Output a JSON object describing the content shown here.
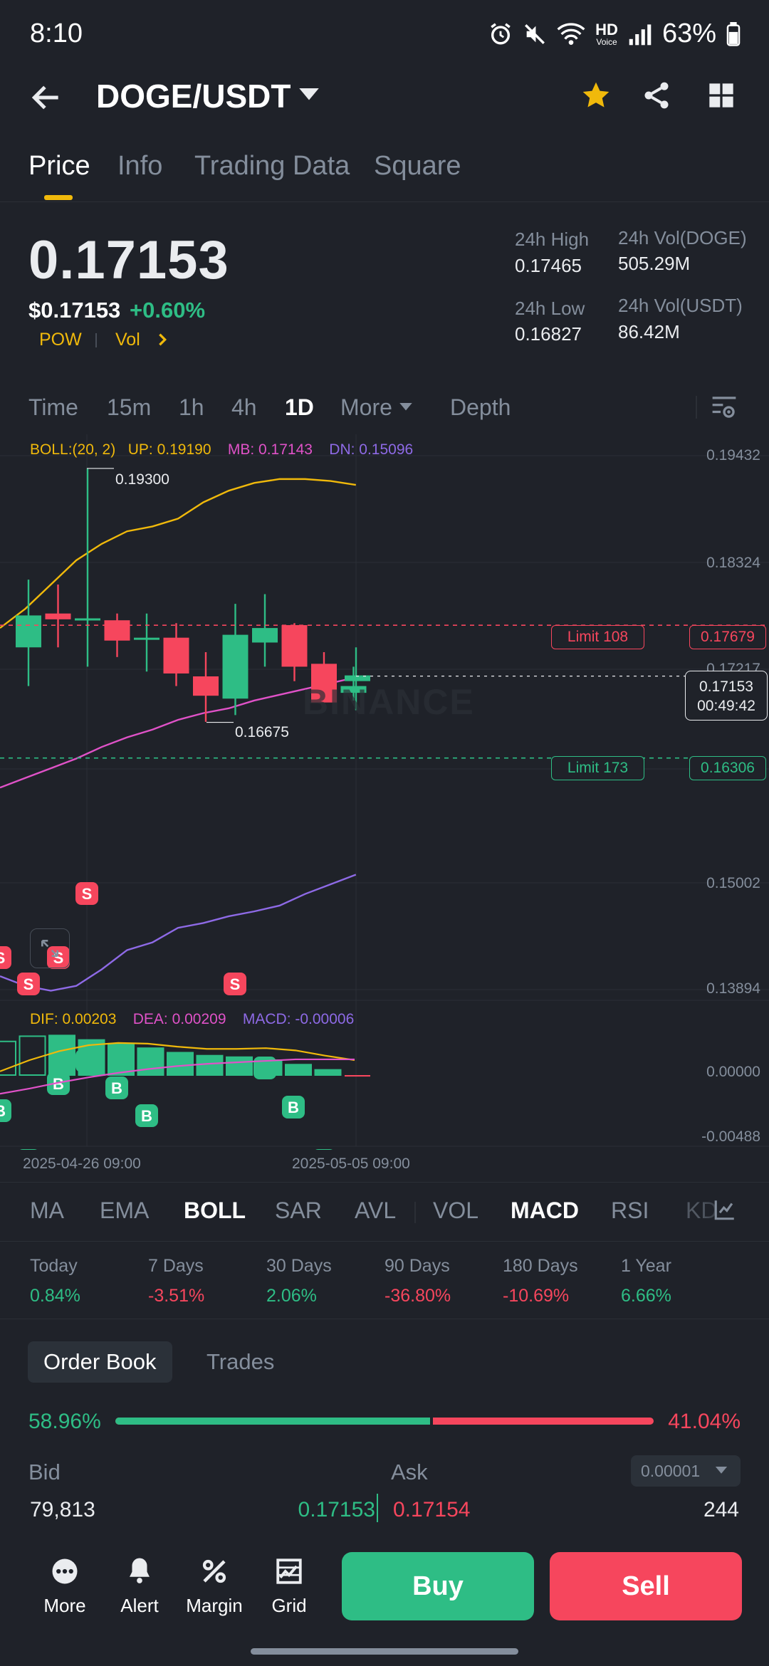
{
  "status_bar": {
    "time": "8:10",
    "hd": "HD",
    "hd_sub": "Voice",
    "battery": "63%"
  },
  "header": {
    "pair": "DOGE/USDT"
  },
  "tabs": [
    {
      "label": "Price"
    },
    {
      "label": "Info"
    },
    {
      "label": "Trading Data"
    },
    {
      "label": "Square"
    }
  ],
  "price": {
    "last": "0.17153",
    "usd": "$0.17153",
    "change": "+0.60%",
    "tag1": "POW",
    "tag2": "Vol",
    "high_label": "24h High",
    "high": "0.17465",
    "low_label": "24h Low",
    "low": "0.16827",
    "vol_base_label": "24h Vol(DOGE)",
    "vol_base": "505.29M",
    "vol_quote_label": "24h Vol(USDT)",
    "vol_quote": "86.42M"
  },
  "intervals": [
    {
      "label": "Time"
    },
    {
      "label": "15m"
    },
    {
      "label": "1h"
    },
    {
      "label": "4h"
    },
    {
      "label": "1D"
    },
    {
      "label": "More"
    },
    {
      "label": "Depth"
    }
  ],
  "chart": {
    "boll": {
      "label": "BOLL:(20, 2)",
      "up": "UP: 0.19190",
      "mb": "MB: 0.17143",
      "dn": "DN: 0.15096"
    },
    "y_ticks": [
      "0.19432",
      "0.18324",
      "0.17217",
      "0.15002",
      "0.13894"
    ],
    "high_mark": "0.19300",
    "low_mark": "0.16675",
    "limit_sell": "Limit  108",
    "limit_sell_price": "0.17679",
    "limit_buy": "Limit  173",
    "limit_buy_price": "0.16306",
    "current_price": "0.17153",
    "countdown": "00:49:42",
    "watermark": "BINANCE",
    "macd": {
      "dif": "DIF: 0.00203",
      "dea": "DEA: 0.00209",
      "macd": "MACD: -0.00006"
    },
    "macd_ticks": [
      "0.00000",
      "-0.00488"
    ],
    "x_ticks": [
      "2025-04-26 09:00",
      "2025-05-05 09:00"
    ],
    "colors": {
      "up": "#2ebd85",
      "down": "#f6465d",
      "boll_up": "#f0b90b",
      "boll_mb": "#e052c8",
      "boll_dn": "#8e6ae6"
    }
  },
  "chart_data": {
    "type": "candlestick",
    "series": [
      {
        "name": "UP",
        "values": [
          0.1765,
          0.1785,
          0.181,
          0.1835,
          0.1852,
          0.1865,
          0.187,
          0.1878,
          0.1895,
          0.1907,
          0.1915,
          0.1919,
          0.1919,
          0.1917,
          0.1913
        ]
      },
      {
        "name": "MB",
        "values": [
          0.16,
          0.161,
          0.162,
          0.163,
          0.1642,
          0.1652,
          0.166,
          0.167,
          0.1677,
          0.1682,
          0.169,
          0.1696,
          0.1702,
          0.1708,
          0.1714
        ]
      },
      {
        "name": "DN",
        "values": [
          0.1405,
          0.1395,
          0.139,
          0.1395,
          0.1412,
          0.1432,
          0.144,
          0.1455,
          0.146,
          0.1467,
          0.1472,
          0.1478,
          0.149,
          0.15,
          0.151
        ]
      }
    ],
    "candles": [
      {
        "o": 0.1745,
        "c": 0.1778,
        "h": 0.1815,
        "l": 0.1705
      },
      {
        "o": 0.178,
        "c": 0.1774,
        "h": 0.181,
        "l": 0.1745
      },
      {
        "o": 0.1775,
        "c": 0.1775,
        "h": 0.193,
        "l": 0.1725
      },
      {
        "o": 0.1773,
        "c": 0.1752,
        "h": 0.178,
        "l": 0.1735
      },
      {
        "o": 0.1755,
        "c": 0.1755,
        "h": 0.178,
        "l": 0.172
      },
      {
        "o": 0.1755,
        "c": 0.1718,
        "h": 0.177,
        "l": 0.1705
      },
      {
        "o": 0.1715,
        "c": 0.1695,
        "h": 0.174,
        "l": 0.1668
      },
      {
        "o": 0.1692,
        "c": 0.1758,
        "h": 0.179,
        "l": 0.1675
      },
      {
        "o": 0.175,
        "c": 0.1765,
        "h": 0.18,
        "l": 0.1725
      },
      {
        "o": 0.1768,
        "c": 0.1725,
        "h": 0.177,
        "l": 0.171
      },
      {
        "o": 0.1728,
        "c": 0.1688,
        "h": 0.174,
        "l": 0.169
      },
      {
        "o": 0.1698,
        "c": 0.1705,
        "h": 0.1725,
        "l": 0.169
      }
    ],
    "macd_hist": [
      0.0045,
      0.0052,
      0.0053,
      0.0047,
      0.0042,
      0.0036,
      0.003,
      0.0026,
      0.0024,
      0.002,
      0.0014,
      0.0007,
      -0.0002
    ],
    "x_ticks": [
      "2025-04-26 09:00",
      "2025-05-05 09:00"
    ]
  },
  "indicators": [
    {
      "label": "MA"
    },
    {
      "label": "EMA"
    },
    {
      "label": "BOLL"
    },
    {
      "label": "SAR"
    },
    {
      "label": "AVL"
    },
    {
      "label": "VOL"
    },
    {
      "label": "MACD"
    },
    {
      "label": "RSI"
    },
    {
      "label": "KD"
    }
  ],
  "performance": [
    {
      "label": "Today",
      "value": "0.84%",
      "dir": "up"
    },
    {
      "label": "7 Days",
      "value": "-3.51%",
      "dir": "down"
    },
    {
      "label": "30 Days",
      "value": "2.06%",
      "dir": "up"
    },
    {
      "label": "90 Days",
      "value": "-36.80%",
      "dir": "down"
    },
    {
      "label": "180 Days",
      "value": "-10.69%",
      "dir": "down"
    },
    {
      "label": "1 Year",
      "value": "6.66%",
      "dir": "up"
    }
  ],
  "orderbook": {
    "tab_book": "Order Book",
    "tab_trades": "Trades",
    "bid_pct": "58.96%",
    "ask_pct": "41.04%",
    "bid_ratio": 0.5896,
    "bid_label": "Bid",
    "ask_label": "Ask",
    "precision": "0.00001",
    "bid_qty": "79,813",
    "bid_price": "0.17153",
    "ask_price": "0.17154",
    "ask_qty": "244"
  },
  "bottom_nav": [
    {
      "label": "More"
    },
    {
      "label": "Alert"
    },
    {
      "label": "Margin"
    },
    {
      "label": "Grid"
    }
  ],
  "actions": {
    "buy": "Buy",
    "sell": "Sell"
  }
}
